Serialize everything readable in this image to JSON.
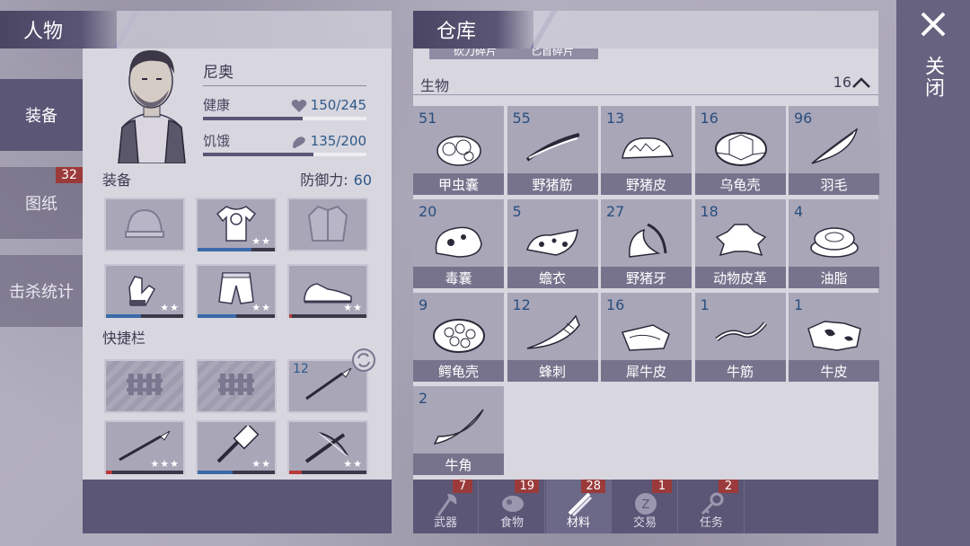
{
  "side_tabs": [
    {
      "label": "装备",
      "active": true
    },
    {
      "label": "图纸",
      "badge": "32"
    },
    {
      "label": "击杀统计"
    }
  ],
  "character": {
    "header": "人物",
    "name": "尼奥",
    "health": {
      "label": "健康",
      "value": "150/245",
      "fraction": 0.61
    },
    "hunger": {
      "label": "饥饿",
      "value": "135/200",
      "fraction": 0.675
    },
    "equipment_label": "装备",
    "defense_label": "防御力:",
    "defense_value": "60",
    "quickbar_label": "快捷栏",
    "quickbar_qty": "12"
  },
  "warehouse": {
    "header": "仓库",
    "cut_items": [
      "砍刀碎片",
      "匕首碎片"
    ],
    "category": {
      "name": "生物",
      "count": "16"
    },
    "items": [
      {
        "qty": "51",
        "name": "甲虫囊",
        "icon": "beetle-sac-icon"
      },
      {
        "qty": "55",
        "name": "野猪筋",
        "icon": "boar-sinew-icon"
      },
      {
        "qty": "13",
        "name": "野猪皮",
        "icon": "boar-hide-icon"
      },
      {
        "qty": "16",
        "name": "乌龟壳",
        "icon": "turtle-shell-icon"
      },
      {
        "qty": "96",
        "name": "羽毛",
        "icon": "feather-icon"
      },
      {
        "qty": "20",
        "name": "毒囊",
        "icon": "poison-sac-icon"
      },
      {
        "qty": "5",
        "name": "蟾衣",
        "icon": "toad-skin-icon"
      },
      {
        "qty": "27",
        "name": "野猪牙",
        "icon": "boar-tusk-icon"
      },
      {
        "qty": "18",
        "name": "动物皮革",
        "icon": "animal-leather-icon"
      },
      {
        "qty": "4",
        "name": "油脂",
        "icon": "fat-icon"
      },
      {
        "qty": "9",
        "name": "鳄龟壳",
        "icon": "croc-turtle-shell-icon"
      },
      {
        "qty": "12",
        "name": "蜂刺",
        "icon": "bee-stinger-icon"
      },
      {
        "qty": "16",
        "name": "犀牛皮",
        "icon": "rhino-hide-icon"
      },
      {
        "qty": "1",
        "name": "牛筋",
        "icon": "ox-sinew-icon"
      },
      {
        "qty": "1",
        "name": "牛皮",
        "icon": "ox-hide-icon"
      },
      {
        "qty": "2",
        "name": "牛角",
        "icon": "ox-horn-icon"
      }
    ]
  },
  "bottom_tabs": [
    {
      "label": "武器",
      "badge": "7"
    },
    {
      "label": "食物",
      "badge": "19"
    },
    {
      "label": "材料",
      "badge": "28",
      "active": true
    },
    {
      "label": "交易",
      "badge": "1"
    },
    {
      "label": "任务",
      "badge": "2"
    }
  ],
  "close_label": "关闭",
  "colors": {
    "accent_blue": "#2e5a8a",
    "badge_red": "#9b3a3a",
    "panel_dark": "#5b5676"
  }
}
